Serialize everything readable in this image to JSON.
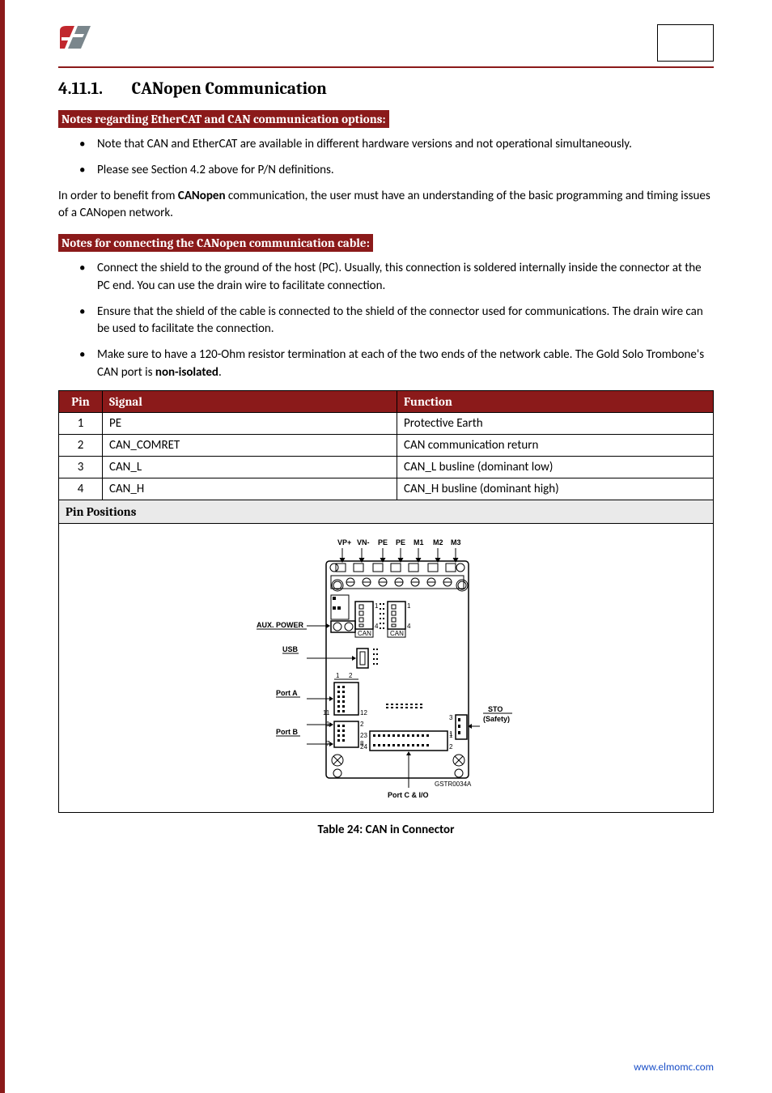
{
  "header": {
    "section_number": "4.11.1.",
    "section_title": "CANopen Communication"
  },
  "banner1": "Notes regarding EtherCAT and CAN communication options:",
  "bullets1": [
    "Note that CAN and EtherCAT are available in different hardware versions and not operational simultaneously.",
    "Please see Section 4.2 above for P/N definitions."
  ],
  "para1_a": "In order to benefit from ",
  "para1_bold": "CANopen",
  "para1_b": " communication, the user must have an understanding of the basic programming and timing issues of a CANopen network.",
  "banner2": "Notes for connecting the CANopen communication cable:",
  "bullets2": [
    "Connect the shield to the ground of the host (PC). Usually, this connection is soldered internally inside the connector at the PC end. You can use the drain wire to facilitate connection.",
    "Ensure that the shield of the cable is connected to the shield of the connector used for communications. The drain wire can be used to facilitate the connection."
  ],
  "bullet2_last_a": "Make sure to have a 120-Ohm resistor termination at each of the two ends of the network cable. The Gold Solo Trombone's CAN port is ",
  "bullet2_last_bold": "non-isolated",
  "bullet2_last_b": ".",
  "table": {
    "headers": {
      "pin": "Pin",
      "signal": "Signal",
      "function": "Function"
    },
    "rows": [
      {
        "pin": "1",
        "signal": "PE",
        "function": "Protective Earth"
      },
      {
        "pin": "2",
        "signal": "CAN_COMRET",
        "function": "CAN communication return"
      },
      {
        "pin": "3",
        "signal": "CAN_L",
        "function": "CAN_L busline (dominant low)"
      },
      {
        "pin": "4",
        "signal": "CAN_H",
        "function": "CAN_H busline (dominant high)"
      }
    ]
  },
  "pin_positions_label": "Pin Positions",
  "diagram": {
    "top_labels": [
      "VP+",
      "VN-",
      "PE",
      "PE",
      "M1",
      "M2",
      "M3"
    ],
    "left_labels": [
      "AUX. POWER",
      "USB",
      "Port A",
      "Port B"
    ],
    "right_labels": [
      "STO",
      "(Safety)"
    ],
    "bottom_label": "Port C & I/O",
    "code": "GSTR0034A",
    "can_label": "CAN",
    "pin_nums": {
      "pa11": "11",
      "pa12": "12",
      "pb1": "1",
      "pb2": "2",
      "pb7": "7",
      "pb8": "8",
      "pc23": "23",
      "pc24": "24",
      "pc_r1": "1",
      "pc_r2": "2",
      "sto1": "1",
      "sto3": "3",
      "c1": "1",
      "c4": "4",
      "usb12_1": "1",
      "usb12_2": "2"
    }
  },
  "caption": "Table 24: CAN in Connector",
  "footer_link": "www.elmomc.com"
}
